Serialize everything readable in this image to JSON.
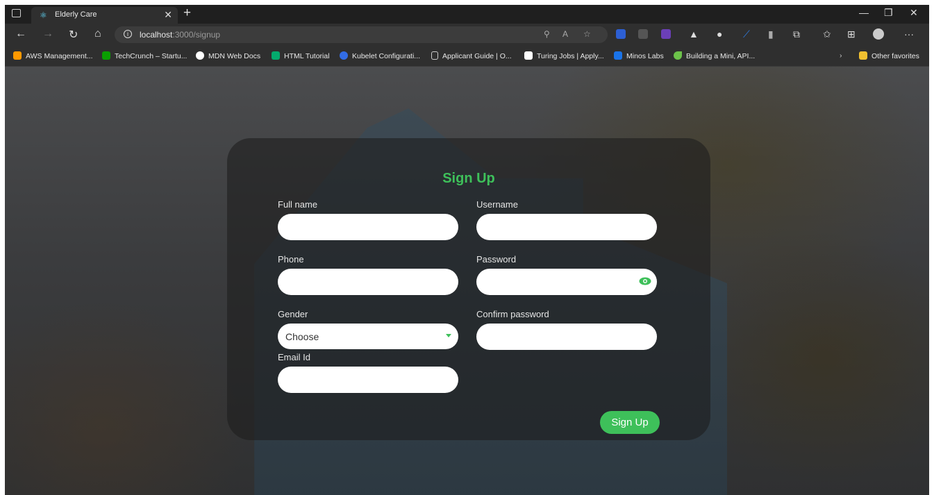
{
  "browser": {
    "tab_title": "Elderly Care",
    "url_host": "localhost",
    "url_path": ":3000/signup",
    "favorites": [
      {
        "label": "AWS Management...",
        "color": "#ff9900"
      },
      {
        "label": "TechCrunch – Startu...",
        "color": "#0a9e01",
        "icon_text": "TC"
      },
      {
        "label": "MDN Web Docs",
        "color": "#ffffff"
      },
      {
        "label": "HTML Tutorial",
        "color": "#04aa6d"
      },
      {
        "label": "Kubelet Configurati...",
        "color": "#326ce5"
      },
      {
        "label": "Applicant Guide | O...",
        "color": "#cccccc"
      },
      {
        "label": "Turing Jobs | Apply...",
        "color": "#ffffff",
        "icon_text": "7"
      },
      {
        "label": "Minos Labs",
        "color": "#1a73e8"
      },
      {
        "label": "Building a Mini, API...",
        "color": "#6cc24a"
      }
    ],
    "other_favorites": "Other favorites"
  },
  "form": {
    "title": "Sign Up",
    "full_name_label": "Full name",
    "username_label": "Username",
    "phone_label": "Phone",
    "password_label": "Password",
    "gender_label": "Gender",
    "gender_value": "Choose",
    "confirm_password_label": "Confirm password",
    "email_label": "Email Id",
    "submit_label": "Sign Up"
  },
  "colors": {
    "accent": "#3ec05a",
    "panel": "rgba(30,30,30,0.62)"
  }
}
